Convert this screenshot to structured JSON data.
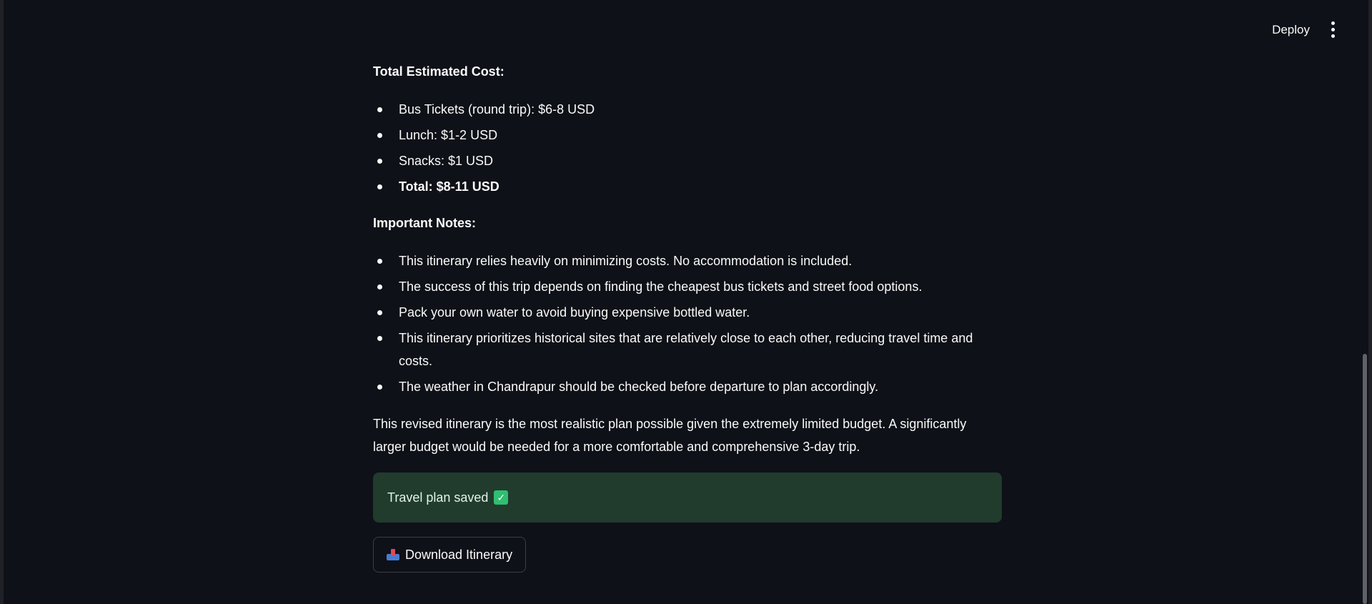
{
  "header": {
    "deploy_label": "Deploy",
    "menu_icon": "vertical-ellipsis-icon"
  },
  "cost": {
    "title": "Total Estimated Cost:",
    "items": [
      {
        "text": "Bus Tickets (round trip): $6-8 USD",
        "bold": false
      },
      {
        "text": "Lunch: $1-2 USD",
        "bold": false
      },
      {
        "text": "Snacks: $1 USD",
        "bold": false
      },
      {
        "text": "Total: $8-11 USD",
        "bold": true
      }
    ]
  },
  "notes": {
    "title": "Important Notes:",
    "items": [
      "This itinerary relies heavily on minimizing costs. No accommodation is included.",
      "The success of this trip depends on finding the cheapest bus tickets and street food options.",
      "Pack your own water to avoid buying expensive bottled water.",
      "This itinerary prioritizes historical sites that are relatively close to each other, reducing travel time and costs.",
      "The weather in Chandrapur should be checked before departure to plan accordingly."
    ]
  },
  "summary": "This revised itinerary is the most realistic plan possible given the extremely limited budget. A significantly larger budget would be needed for a more comfortable and comprehensive 3-day trip.",
  "alert": {
    "text": "Travel plan saved",
    "icon": "check-mark-icon",
    "color": "#213b2d"
  },
  "download": {
    "label": "Download Itinerary",
    "icon": "inbox-tray-icon"
  }
}
